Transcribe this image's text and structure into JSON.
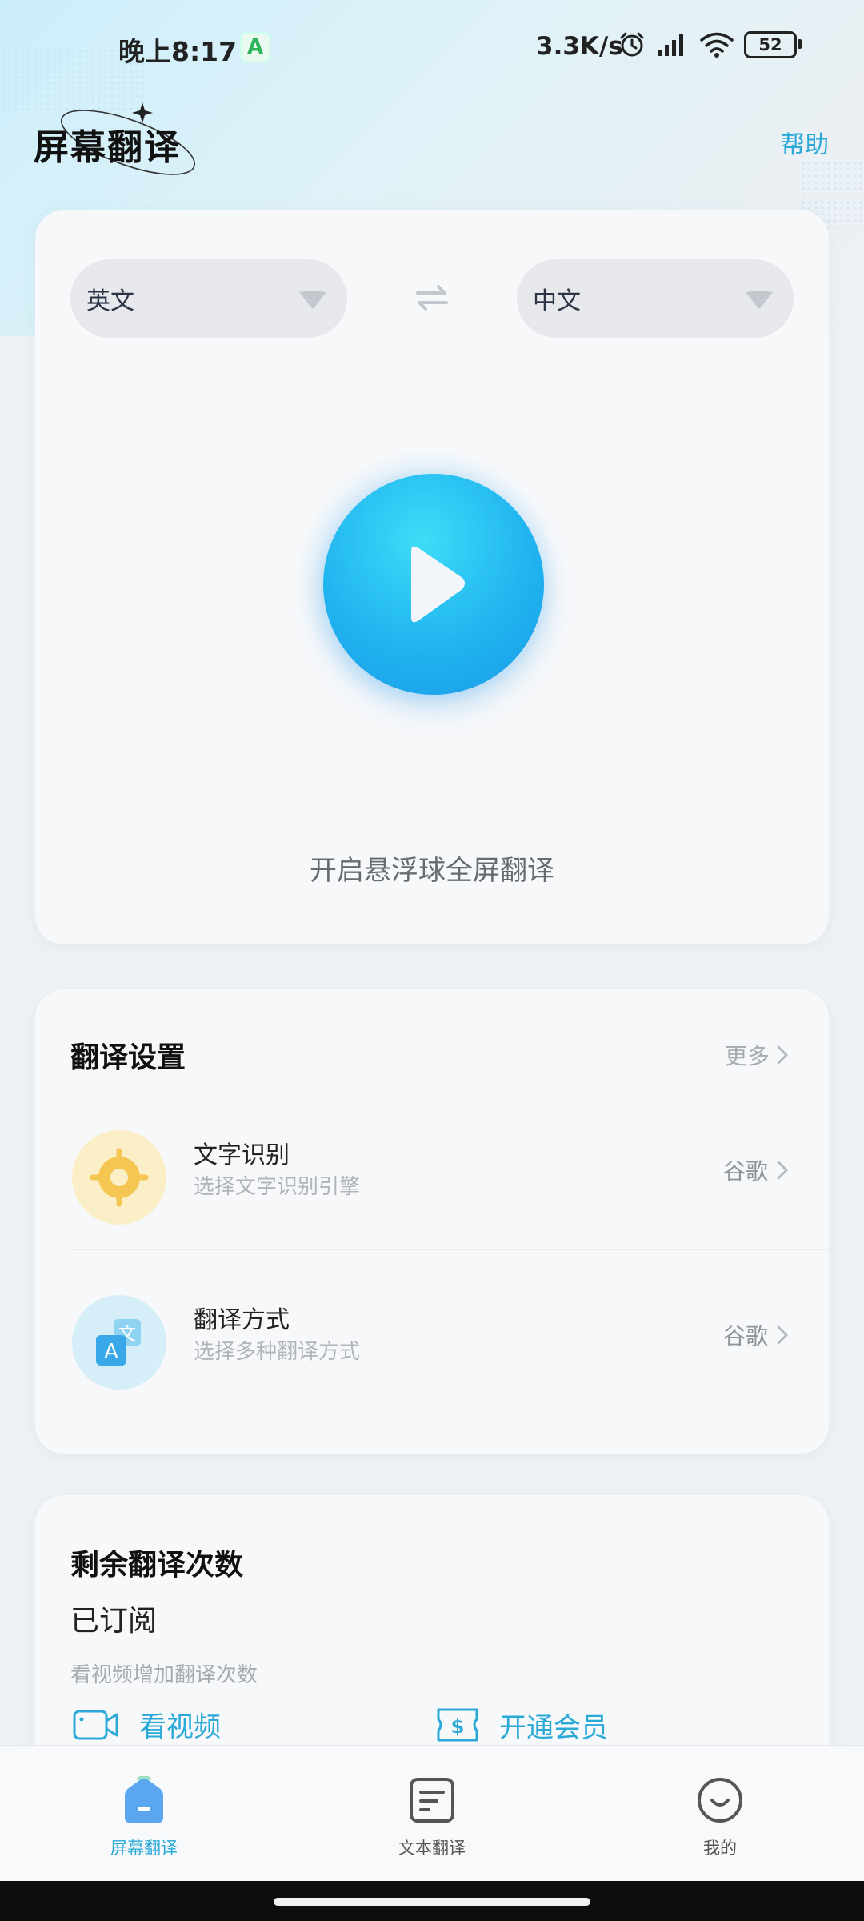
{
  "status_bar": {
    "time": "晚上8:17",
    "net_speed": "3.3K/s",
    "battery": "52",
    "app_badge": "A"
  },
  "header": {
    "title": "屏幕翻译",
    "help": "帮助"
  },
  "translator": {
    "source_lang": "英文",
    "target_lang": "中文",
    "start_label": "开启悬浮球全屏翻译"
  },
  "settings": {
    "title": "翻译设置",
    "more": "更多",
    "items": [
      {
        "title": "文字识别",
        "subtitle": "选择文字识别引擎",
        "value": "谷歌"
      },
      {
        "title": "翻译方式",
        "subtitle": "选择多种翻译方式",
        "value": "谷歌"
      }
    ]
  },
  "remaining": {
    "title": "剩余翻译次数",
    "status": "已订阅",
    "hint": "看视频增加翻译次数",
    "watch_video": "看视频",
    "open_member": "开通会员"
  },
  "bottom_nav": {
    "items": [
      {
        "label": "屏幕翻译",
        "active": true
      },
      {
        "label": "文本翻译",
        "active": false
      },
      {
        "label": "我的",
        "active": false
      }
    ]
  },
  "colors": {
    "accent": "#2aa9d8",
    "play_button": "#20b4f0",
    "ocr_icon_bg": "#fbefc8",
    "translate_icon_bg": "#d6eef8"
  }
}
